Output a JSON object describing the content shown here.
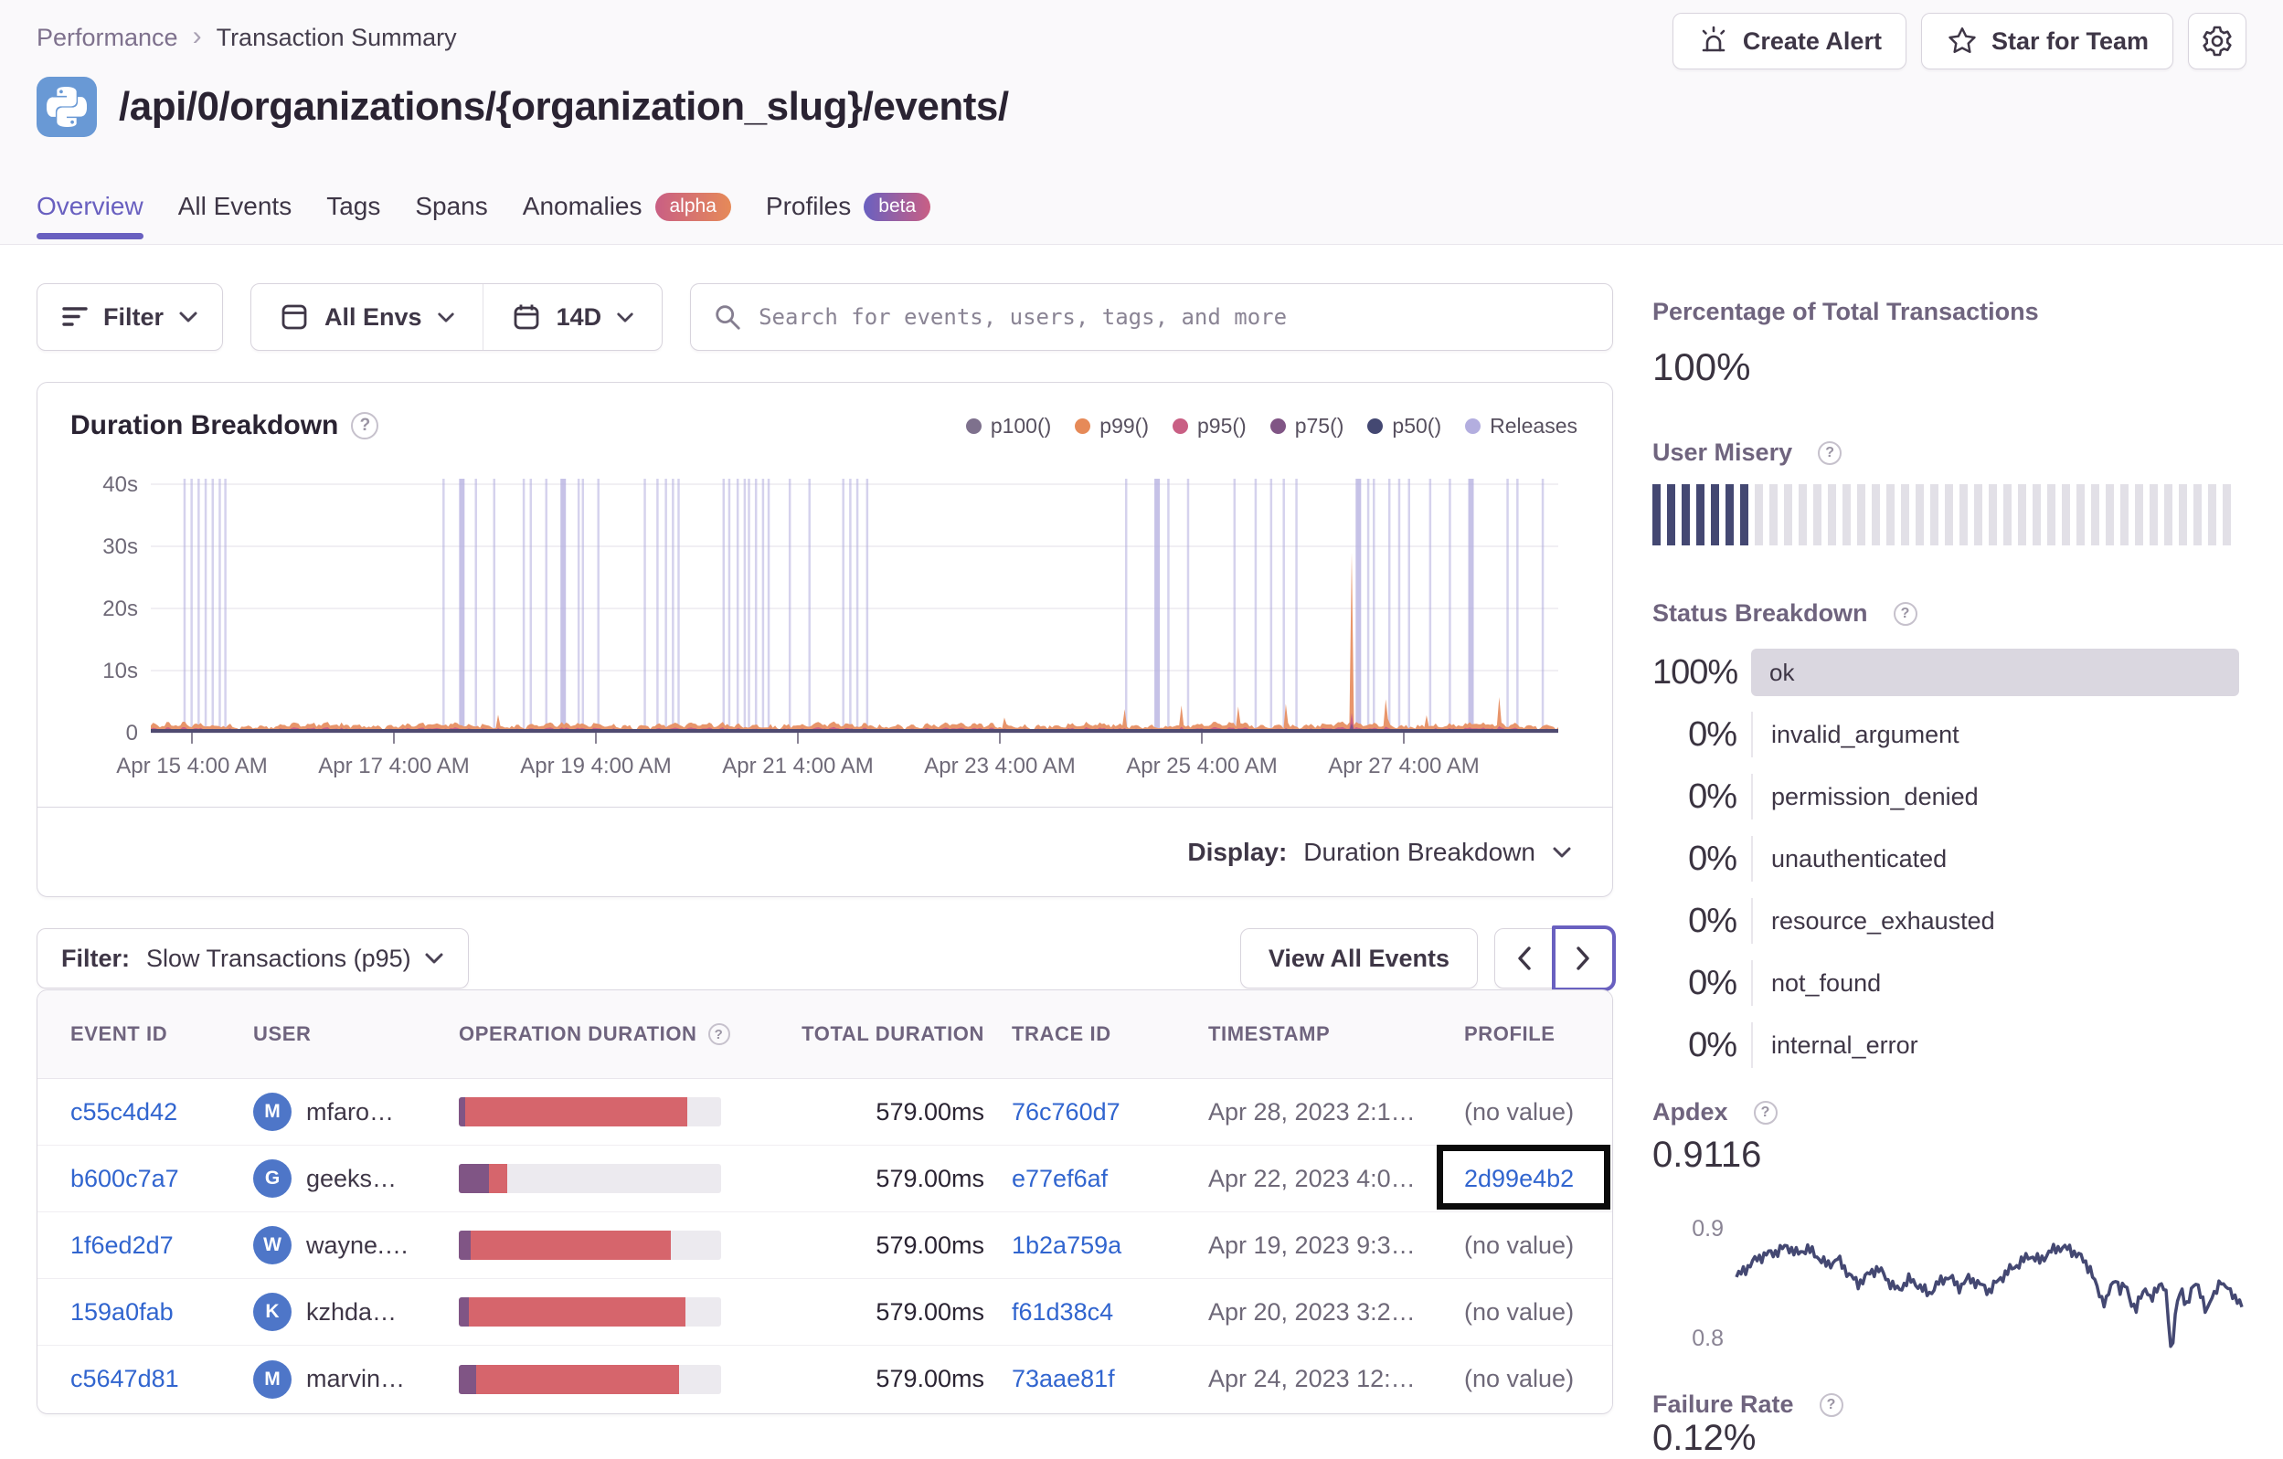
{
  "breadcrumb": {
    "items": [
      "Performance",
      "Transaction Summary"
    ]
  },
  "actions": {
    "create_alert": "Create Alert",
    "star_for_team": "Star for Team"
  },
  "page": {
    "title": "/api/0/organizations/{organization_slug}/events/"
  },
  "tabs": [
    {
      "label": "Overview",
      "active": true
    },
    {
      "label": "All Events"
    },
    {
      "label": "Tags"
    },
    {
      "label": "Spans"
    },
    {
      "label": "Anomalies",
      "badge": "alpha"
    },
    {
      "label": "Profiles",
      "badge": "beta"
    }
  ],
  "filters": {
    "filter_label": "Filter",
    "env_label": "All Envs",
    "date_label": "14D",
    "search_placeholder": "Search for events, users, tags, and more"
  },
  "chart_data": [
    {
      "name": "duration_breakdown",
      "type": "area",
      "title": "Duration Breakdown",
      "legend": [
        {
          "name": "p100()",
          "color": "#7e718d"
        },
        {
          "name": "p99()",
          "color": "#e68a58"
        },
        {
          "name": "p95()",
          "color": "#c95f84"
        },
        {
          "name": "p75()",
          "color": "#805585"
        },
        {
          "name": "p50()",
          "color": "#444872"
        },
        {
          "name": "Releases",
          "color": "#b3aedf"
        }
      ],
      "y_ticks": [
        "40s",
        "30s",
        "20s",
        "10s",
        "0"
      ],
      "y_max_seconds": 40,
      "x_ticks": [
        "Apr 15 4:00 AM",
        "Apr 17 4:00 AM",
        "Apr 19 4:00 AM",
        "Apr 21 4:00 AM",
        "Apr 23 4:00 AM",
        "Apr 25 4:00 AM",
        "Apr 27 4:00 AM"
      ],
      "baseline_seconds": 1.1,
      "noise_seconds": 0.9,
      "spikes": [
        {
          "f": 0.247,
          "s": 1.8
        },
        {
          "f": 0.607,
          "s": 2.5
        },
        {
          "f": 0.692,
          "s": 2.8
        },
        {
          "f": 0.732,
          "s": 3.5
        },
        {
          "f": 0.773,
          "s": 5.0
        },
        {
          "f": 0.807,
          "s": 7.5
        },
        {
          "f": 0.853,
          "s": 31.0
        },
        {
          "f": 0.878,
          "s": 9.0
        },
        {
          "f": 0.906,
          "s": 3.5
        },
        {
          "f": 0.958,
          "s": 4.5
        }
      ],
      "releases": {
        "color": "#b3aedf",
        "lines": [
          0.024,
          0.029,
          0.034,
          0.039,
          0.044,
          0.049,
          0.053,
          0.208,
          0.221,
          0.231,
          0.244,
          0.265,
          0.27,
          0.281,
          0.293,
          0.304,
          0.307,
          0.318,
          0.351,
          0.36,
          0.366,
          0.371,
          0.375,
          0.407,
          0.411,
          0.417,
          0.422,
          0.425,
          0.43,
          0.435,
          0.439,
          0.454,
          0.468,
          0.492,
          0.497,
          0.502,
          0.509,
          0.693,
          0.715,
          0.723,
          0.737,
          0.77,
          0.785,
          0.796,
          0.805,
          0.814,
          0.858,
          0.865,
          0.869,
          0.88,
          0.887,
          0.894,
          0.909,
          0.923,
          0.938,
          0.964,
          0.971,
          0.989
        ],
        "wide": [
          0.221,
          0.293,
          0.715,
          0.858,
          0.938
        ]
      }
    },
    {
      "name": "apdex_trend",
      "type": "line",
      "color": "#444872",
      "y_top_label": "0.9",
      "y_bottom_label": "0.8",
      "points_f": [
        0,
        0.02,
        0.04,
        0.06,
        0.08,
        0.1,
        0.12,
        0.14,
        0.16,
        0.18,
        0.2,
        0.22,
        0.24,
        0.26,
        0.28,
        0.3,
        0.32,
        0.34,
        0.36,
        0.38,
        0.4,
        0.42,
        0.44,
        0.46,
        0.48,
        0.5,
        0.52,
        0.54,
        0.56,
        0.58,
        0.6,
        0.62,
        0.64,
        0.66,
        0.68,
        0.7,
        0.71,
        0.72,
        0.73,
        0.74,
        0.75,
        0.76,
        0.77,
        0.78,
        0.79,
        0.8,
        0.81,
        0.815,
        0.82,
        0.83,
        0.84,
        0.85,
        0.855,
        0.86,
        0.87,
        0.88,
        0.885,
        0.89,
        0.9,
        0.91,
        0.92,
        0.93,
        0.94,
        0.95,
        0.96,
        0.965,
        0.97,
        0.98,
        0.985,
        1
      ],
      "points_v": [
        0.858,
        0.866,
        0.874,
        0.878,
        0.88,
        0.885,
        0.878,
        0.883,
        0.876,
        0.868,
        0.874,
        0.862,
        0.852,
        0.86,
        0.866,
        0.855,
        0.846,
        0.856,
        0.851,
        0.843,
        0.853,
        0.859,
        0.849,
        0.857,
        0.852,
        0.846,
        0.856,
        0.864,
        0.87,
        0.877,
        0.872,
        0.88,
        0.884,
        0.882,
        0.876,
        0.865,
        0.852,
        0.842,
        0.835,
        0.848,
        0.858,
        0.845,
        0.852,
        0.838,
        0.828,
        0.842,
        0.85,
        0.843,
        0.835,
        0.848,
        0.854,
        0.842,
        0.82,
        0.79,
        0.833,
        0.846,
        0.84,
        0.834,
        0.846,
        0.852,
        0.844,
        0.825,
        0.84,
        0.849,
        0.854,
        0.846,
        0.852,
        0.846,
        0.838,
        0.834
      ]
    }
  ],
  "display": {
    "label": "Display:",
    "value": "Duration Breakdown"
  },
  "events_filter": {
    "label": "Filter:",
    "value": "Slow Transactions (p95)",
    "view_all": "View All Events"
  },
  "table": {
    "columns": [
      "Event ID",
      "User",
      "Operation Duration",
      "Total Duration",
      "Trace ID",
      "Timestamp",
      "Profile"
    ],
    "rows": [
      {
        "event_id": "c55c4d42",
        "user": "mfaro…",
        "avatar": "M",
        "op_p75": 0.025,
        "op_p95": 0.845,
        "total": "579.00ms",
        "trace": "76c760d7",
        "timestamp": "Apr 28, 2023 2:1…",
        "profile": "(no value)"
      },
      {
        "event_id": "b600c7a7",
        "user": "geeks…",
        "avatar": "G",
        "op_p75": 0.115,
        "op_p95": 0.07,
        "total": "579.00ms",
        "trace": "e77ef6af",
        "timestamp": "Apr 22, 2023 4:0…",
        "profile": "2d99e4b2",
        "profile_link": true,
        "annotated": true
      },
      {
        "event_id": "1f6ed2d7",
        "user": "wayne.…",
        "avatar": "W",
        "op_p75": 0.045,
        "op_p95": 0.765,
        "total": "579.00ms",
        "trace": "1b2a759a",
        "timestamp": "Apr 19, 2023 9:3…",
        "profile": "(no value)"
      },
      {
        "event_id": "159a0fab",
        "user": "kzhda…",
        "avatar": "K",
        "op_p75": 0.04,
        "op_p95": 0.825,
        "total": "579.00ms",
        "trace": "f61d38c4",
        "timestamp": "Apr 20, 2023 3:2…",
        "profile": "(no value)"
      },
      {
        "event_id": "c5647d81",
        "user": "marvin…",
        "avatar": "M",
        "op_p75": 0.065,
        "op_p95": 0.775,
        "total": "579.00ms",
        "trace": "73aae81f",
        "timestamp": "Apr 24, 2023 12:…",
        "profile": "(no value)"
      }
    ]
  },
  "sidebar": {
    "pct_total": {
      "label": "Percentage of Total Transactions",
      "value": "100%"
    },
    "user_misery": {
      "label": "User Misery",
      "total_stripes": 40,
      "filled_stripes": 7,
      "fill_color": "#444872",
      "empty_color": "#e2e0e7"
    },
    "status_breakdown": {
      "label": "Status Breakdown",
      "rows": [
        {
          "pct": "100%",
          "name": "ok",
          "bar": true
        },
        {
          "pct": "0%",
          "name": "invalid_argument"
        },
        {
          "pct": "0%",
          "name": "permission_denied"
        },
        {
          "pct": "0%",
          "name": "unauthenticated"
        },
        {
          "pct": "0%",
          "name": "resource_exhausted"
        },
        {
          "pct": "0%",
          "name": "not_found"
        },
        {
          "pct": "0%",
          "name": "internal_error"
        }
      ]
    },
    "apdex": {
      "label": "Apdex",
      "value": "0.9116"
    },
    "failure_rate": {
      "label": "Failure Rate",
      "value": "0.12%"
    }
  },
  "colors": {
    "accent": "#6960c0",
    "link": "#3165cf",
    "avatar": "#4e76c8",
    "python_tile": "#6999d5",
    "op_p75": "#805585",
    "op_p95": "#d6656c"
  }
}
